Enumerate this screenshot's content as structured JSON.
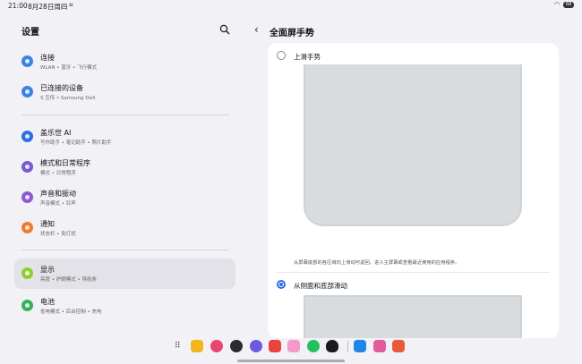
{
  "status_bar": {
    "time": "21:00",
    "date": "8月28日周四",
    "screenshot_icon": "screenshot-icon",
    "battery": "68"
  },
  "left_pane": {
    "title": "设置",
    "search_icon": "search-icon",
    "items": [
      {
        "title": "连接",
        "subtitle": "WLAN • 蓝牙 • 飞行模式",
        "icon": "wifi-icon",
        "color": "#3b82e6"
      },
      {
        "title": "已连接的设备",
        "subtitle": "S 互传 • Samsung DeX",
        "icon": "devices-icon",
        "color": "#3b82e6"
      },
      {
        "title": "盖乐世 AI",
        "subtitle": "写作助手 • 笔记助手 • 照片助手",
        "icon": "ai-icon",
        "color": "#2d6fdc"
      },
      {
        "title": "模式和日常程序",
        "subtitle": "模式 • 日常程序",
        "icon": "modes-icon",
        "color": "#7a58d6"
      },
      {
        "title": "声音和振动",
        "subtitle": "声音模式 • 铃声",
        "icon": "sound-icon",
        "color": "#8b5ad8"
      },
      {
        "title": "通知",
        "subtitle": "状态栏 • 免打扰",
        "icon": "notification-icon",
        "color": "#f07a2c"
      },
      {
        "title": "显示",
        "subtitle": "亮度 • 护眼模式 • 导航条",
        "icon": "display-icon",
        "color": "#8ccf2e"
      },
      {
        "title": "电池",
        "subtitle": "省电模式 • 后台控制 • 充电",
        "icon": "battery-icon",
        "color": "#3aad5c"
      }
    ]
  },
  "right_pane": {
    "back_icon": "back-arrow-icon",
    "title": "全面屏手势",
    "option1_label": "上滑手势",
    "option1_description": "从屏幕底部的各区域向上滑动可返回、进入主屏幕或查看最近使用的应用程序。",
    "option2_label": "从侧面和底部滑动"
  },
  "dock": {
    "apps_grid_icon": "apps-grid-icon",
    "apps": [
      {
        "name": "notes-app-icon",
        "color": "#f2b51d"
      },
      {
        "name": "gallery-app-icon",
        "color": "#e8456f"
      },
      {
        "name": "camera-app-icon",
        "color": "#2b2b2b"
      },
      {
        "name": "browser-app-icon",
        "color": "#6b5be0"
      },
      {
        "name": "music-app-icon",
        "color": "#e8433c"
      },
      {
        "name": "store-app-icon",
        "color": "#f59ac8"
      },
      {
        "name": "wechat-app-icon",
        "color": "#22c15e"
      },
      {
        "name": "qq-app-icon",
        "color": "#1b1b1b"
      },
      {
        "name": "app-blue-icon",
        "color": "#1f86e8"
      },
      {
        "name": "app-pink-icon",
        "color": "#e35a9d"
      },
      {
        "name": "app-red-icon",
        "color": "#e85b3a"
      }
    ]
  }
}
